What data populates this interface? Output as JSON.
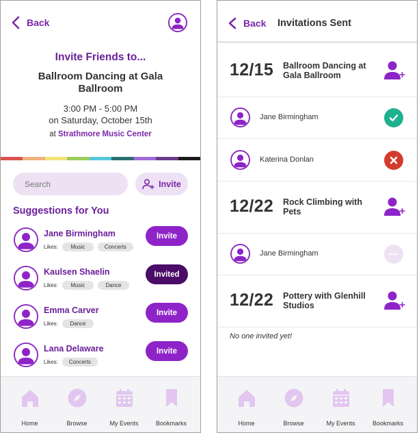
{
  "colors": {
    "accent": "#8e24c8",
    "accent_dark": "#4a0c66",
    "heading": "#6b1f9a",
    "pill_bg": "#ede1f3",
    "nav_icon": "#e2c6f0",
    "accepted": "#1fb090",
    "declined": "#d23c2c"
  },
  "left": {
    "back_label": "Back",
    "heading": "Invite Friends to...",
    "event_name": "Ballroom Dancing at Gala Ballroom",
    "time_line": "3:00 PM - 5:00 PM",
    "date_line": "on Saturday, October 15th",
    "venue_prefix": "at",
    "venue_name": "Strathmore Music Center",
    "rainbow": [
      "#d9534f",
      "#f0b27a",
      "#f4e27a",
      "#9ccc5a",
      "#56c8d8",
      "#2a6f6f",
      "#a06ad9",
      "#6b3a8a",
      "#1c1c1c"
    ],
    "search_placeholder": "Search",
    "invite_label": "Invite",
    "suggestions_title": "Suggestions for You",
    "likes_label": "Likes:",
    "suggestions": [
      {
        "name": "Jane Birmingham",
        "likes": [
          "Music",
          "Concerts"
        ],
        "button": "Invite",
        "state": "invite"
      },
      {
        "name": "Kaulsen Shaelin",
        "likes": [
          "Music",
          "Dance"
        ],
        "button": "Invited",
        "state": "invited"
      },
      {
        "name": "Emma Carver",
        "likes": [
          "Dance"
        ],
        "button": "Invite",
        "state": "invite"
      },
      {
        "name": "Lana Delaware",
        "likes": [
          "Concerts"
        ],
        "button": "Invite",
        "state": "invite"
      }
    ]
  },
  "right": {
    "back_label": "Back",
    "title": "Invitations Sent",
    "events": [
      {
        "date": "12/15",
        "title": "Ballroom Dancing at Gala Ballroom",
        "invitees": [
          {
            "name": "Jane Birmingham",
            "status": "accepted"
          },
          {
            "name": "Katerina Donlan",
            "status": "declined"
          }
        ]
      },
      {
        "date": "12/22",
        "title": "Rock Climbing with Pets",
        "invitees": [
          {
            "name": "Jane Birmingham",
            "status": "pending"
          }
        ]
      },
      {
        "date": "12/22",
        "title": "Pottery with Glenhill Studios",
        "invitees": [],
        "empty_text": "No one invited yet!"
      }
    ]
  },
  "nav": [
    {
      "label": "Home",
      "icon": "home-icon"
    },
    {
      "label": "Browse",
      "icon": "compass-icon"
    },
    {
      "label": "My Events",
      "icon": "calendar-icon"
    },
    {
      "label": "Bookmarks",
      "icon": "bookmark-icon"
    }
  ]
}
